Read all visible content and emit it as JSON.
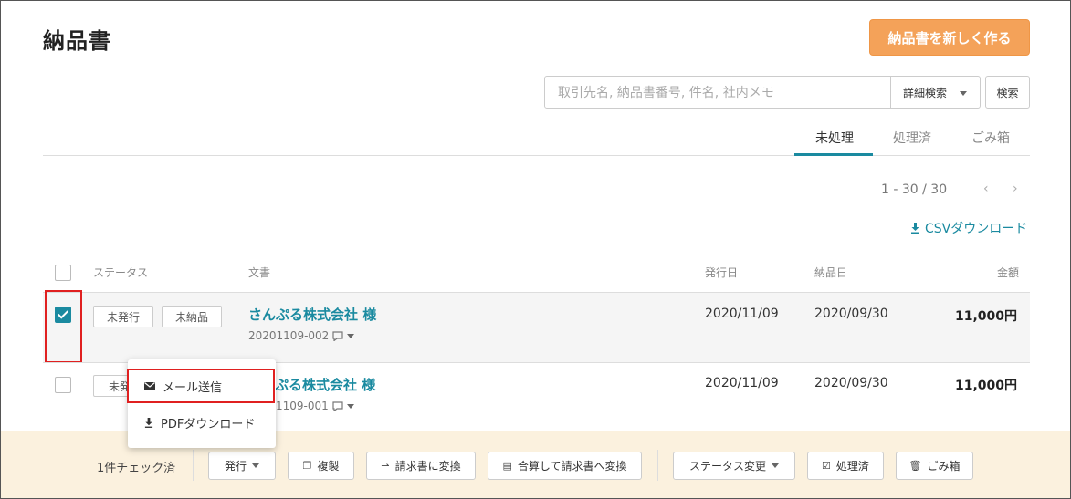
{
  "header": {
    "title": "納品書",
    "new_button": "納品書を新しく作る",
    "accent_color": "#f4a259"
  },
  "search": {
    "placeholder": "取引先名, 納品書番号, 件名, 社内メモ",
    "advanced_label": "詳細検索",
    "button": "検索"
  },
  "tabs": [
    {
      "label": "未処理",
      "active": true
    },
    {
      "label": "処理済",
      "active": false
    },
    {
      "label": "ごみ箱",
      "active": false
    }
  ],
  "pagination": {
    "range": "1 - 30 / 30",
    "prev_icon": "‹",
    "next_icon": "›"
  },
  "csv_link": "CSVダウンロード",
  "table": {
    "headers": {
      "status": "ステータス",
      "document": "文書",
      "issue_date": "発行日",
      "delivery_date": "納品日",
      "amount": "金額"
    },
    "rows": [
      {
        "checked": true,
        "badges": [
          "未発行",
          "未納品"
        ],
        "title": "さんぷる株式会社 様",
        "number": "20201109-002",
        "issue_date": "2020/11/09",
        "delivery_date": "2020/09/30",
        "amount": "11,000円"
      },
      {
        "checked": false,
        "badges": [
          "未発"
        ],
        "title": "ぷる株式会社 様",
        "number": "1109-001",
        "issue_date": "2020/11/09",
        "delivery_date": "2020/09/30",
        "amount": "11,000円"
      }
    ]
  },
  "dropdown": {
    "items": [
      {
        "label": "メール送信",
        "icon": "mail-icon"
      },
      {
        "label": "PDFダウンロード",
        "icon": "download-icon"
      }
    ]
  },
  "bottom_bar": {
    "checked_count": "1件チェック済",
    "buttons": {
      "issue": "発行",
      "duplicate": "複製",
      "to_invoice": "請求書に変換",
      "merge_invoice": "合算して請求書へ変換",
      "status_change": "ステータス変更",
      "processed": "処理済",
      "trash": "ごみ箱"
    }
  },
  "colors": {
    "link": "#1a8aa0",
    "highlight_border": "#e02020",
    "bottom_bar_bg": "#fbf1de"
  }
}
